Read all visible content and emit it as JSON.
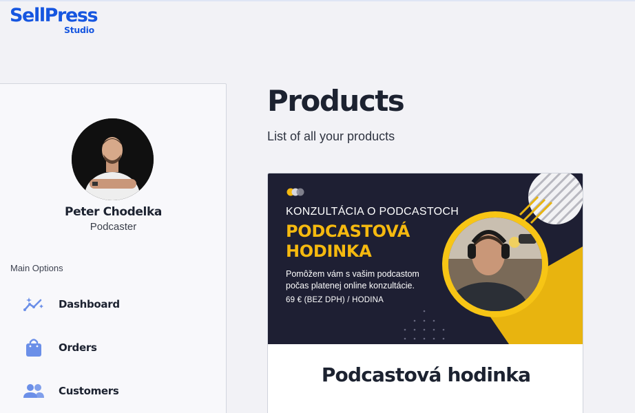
{
  "brand": {
    "name": "SellPress",
    "sub": "Studio",
    "color": "#1656e0"
  },
  "profile": {
    "name": "Peter Chodelka",
    "role": "Podcaster"
  },
  "sidebar": {
    "section_label": "Main Options",
    "items": [
      {
        "label": "Dashboard",
        "icon": "dashboard-sparkle-chart-icon"
      },
      {
        "label": "Orders",
        "icon": "shopping-bag-icon"
      },
      {
        "label": "Customers",
        "icon": "users-icon"
      }
    ]
  },
  "main": {
    "title": "Products",
    "subtitle": "List of all your products"
  },
  "products": [
    {
      "banner": {
        "kicker": "KONZULTÁCIA O PODCASTOCH",
        "title": "PODCASTOVÁ HODINKA",
        "description": "Pomôžem vám s vašim podcastom počas platenej online konzultácie.",
        "price": "69 € (BEZ DPH) / HODINA"
      },
      "name": "Podcastová hodinka"
    }
  ],
  "colors": {
    "accent": "#1656e0",
    "icon": "#6b8fe8",
    "banner_bg": "#1e1f33",
    "banner_yellow": "#f5b90f"
  }
}
